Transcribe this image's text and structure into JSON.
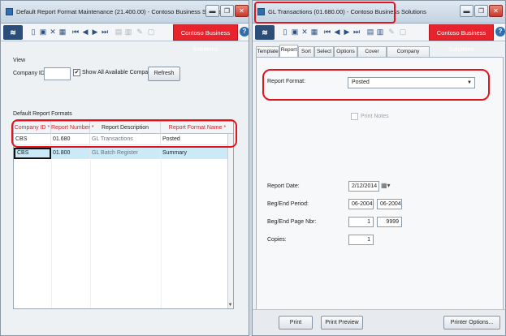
{
  "window1": {
    "title": "Default Report Format Maintenance (21.400.00) - Contoso Business Solutions",
    "brand": "Contoso Business Solutions",
    "view_label": "View",
    "company_id_label": "Company ID:",
    "company_id_value": "",
    "show_all_label": "Show All Available Companies",
    "show_all_checked": "✔",
    "refresh_label": "Refresh",
    "section_label": "Default Report Formats",
    "columns": [
      "Company ID *",
      "Report Number *",
      "Report Description",
      "Report Format Name *"
    ],
    "rows": [
      [
        "CBS",
        "01.680",
        "GL Transactions",
        "Posted"
      ],
      [
        "CBS",
        "01.800",
        "GL Batch Register",
        "Summary"
      ]
    ]
  },
  "window2": {
    "title": "GL Transactions (01.680.00) - Contoso Business Solutions",
    "brand": "Contoso Business Solutions",
    "tabs": [
      "Template",
      "Report",
      "Sort",
      "Select",
      "Options",
      "Cover Page",
      "Company Selection"
    ],
    "active_tab": "Report",
    "report_format_label": "Report Format:",
    "report_format_value": "Posted",
    "print_notes_label": "Print Notes",
    "report_date_label": "Report Date:",
    "report_date_value": "2/12/2014",
    "beg_end_period_label": "Beg/End Period:",
    "beg_period": "06-2004",
    "end_period": "06-2004",
    "beg_end_page_label": "Beg/End Page Nbr:",
    "beg_page": "1",
    "end_page": "9999",
    "copies_label": "Copies:",
    "copies_value": "1",
    "print_label": "Print",
    "print_preview_label": "Print Preview",
    "printer_options_label": "Printer Options..."
  },
  "colors": {
    "highlight": "#e0151f",
    "brand_red": "#e8232d",
    "selected_row": "#cce9f7",
    "required_text": "#d21f2a"
  }
}
